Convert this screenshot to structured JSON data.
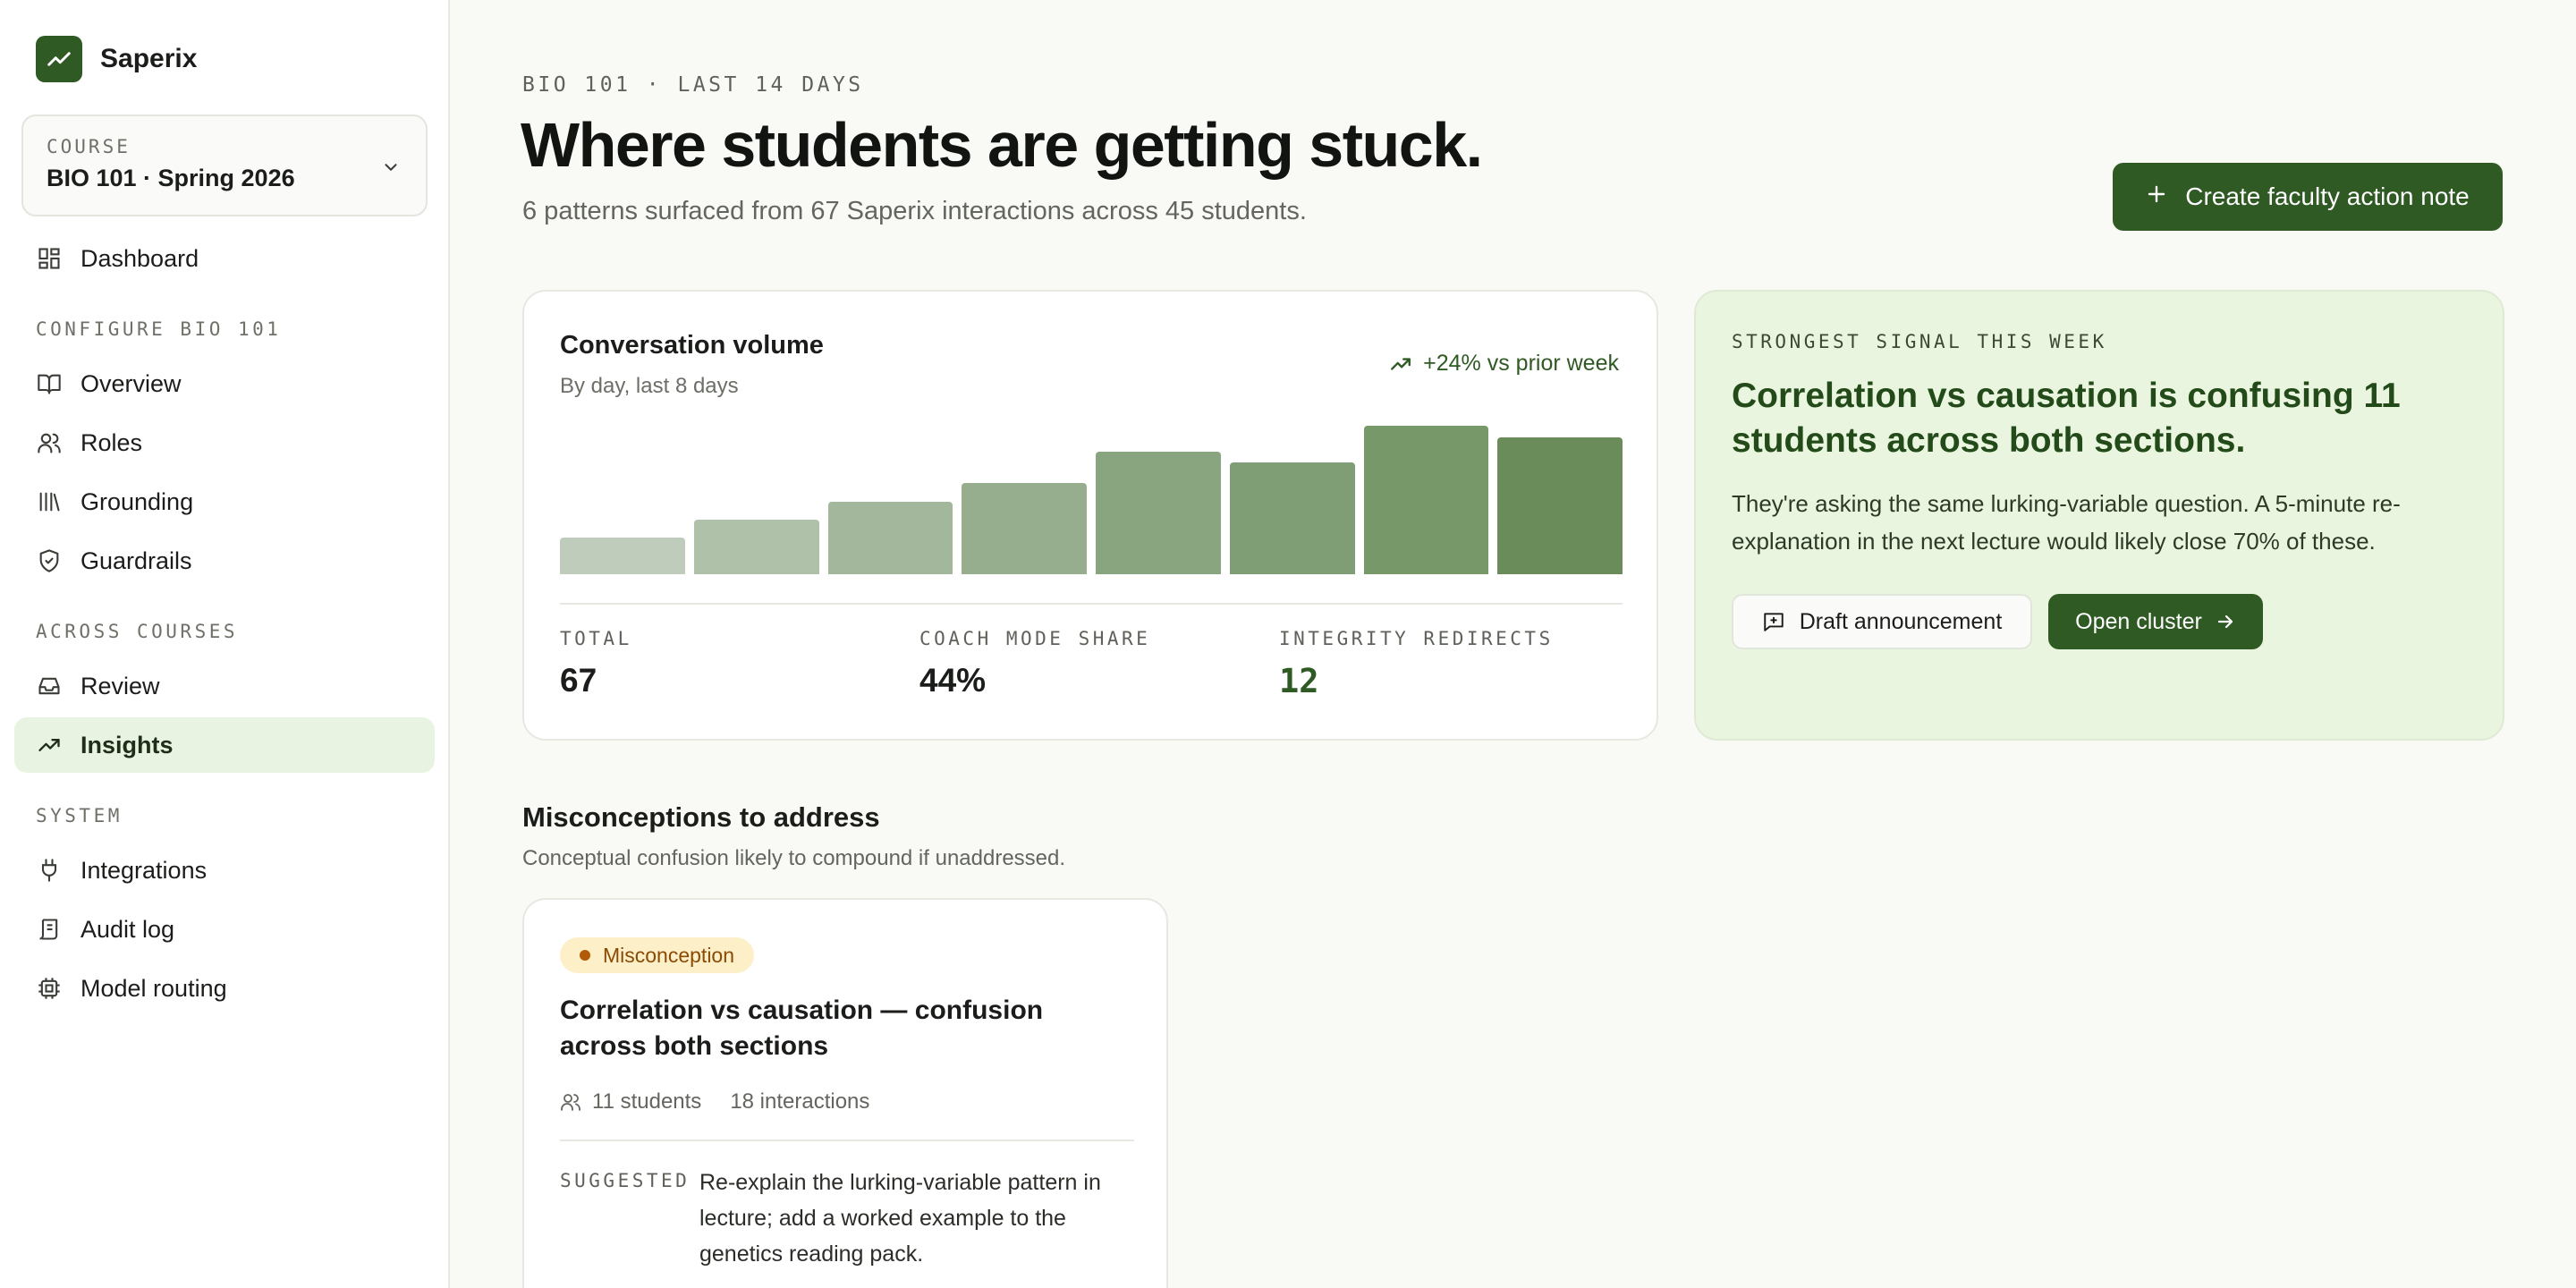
{
  "app": {
    "name": "Saperix"
  },
  "course": {
    "label": "COURSE",
    "value": "BIO 101 · Spring 2026"
  },
  "nav": {
    "dashboard": "Dashboard",
    "section_configure": "CONFIGURE BIO 101",
    "overview": "Overview",
    "roles": "Roles",
    "grounding": "Grounding",
    "guardrails": "Guardrails",
    "section_across": "ACROSS COURSES",
    "review": "Review",
    "insights": "Insights",
    "section_system": "SYSTEM",
    "integrations": "Integrations",
    "audit_log": "Audit log",
    "model_routing": "Model routing",
    "active": "Insights"
  },
  "header": {
    "eyebrow": "BIO 101 · LAST 14 DAYS",
    "title": "Where students are getting stuck.",
    "subtitle": "6 patterns surfaced from 67 Saperix interactions across 45 students.",
    "action_label": "Create faculty action note"
  },
  "volume": {
    "title": "Conversation volume",
    "subtitle": "By day, last 8 days",
    "trend": "+24% vs prior week",
    "stats": {
      "total_label": "TOTAL",
      "total_value": "67",
      "coach_label": "COACH MODE SHARE",
      "coach_value": "44%",
      "integrity_label": "INTEGRITY REDIRECTS",
      "integrity_value": "12"
    }
  },
  "chart_data": {
    "type": "bar",
    "title": "Conversation volume",
    "subtitle": "By day, last 8 days",
    "values": [
      4,
      6,
      8,
      10,
      13.5,
      12.3,
      16.3,
      15
    ],
    "ylim": [
      0,
      16.3
    ],
    "colors": [
      "#c0ccbb",
      "#b0c1aa",
      "#a2b79b",
      "#96ae8e",
      "#89a580",
      "#809e76",
      "#779868",
      "#6a8b5a"
    ]
  },
  "signal": {
    "eyebrow": "STRONGEST SIGNAL THIS WEEK",
    "title": "Correlation vs causation is confusing 11 students across both sections.",
    "body": "They're asking the same lurking-variable question. A 5-minute re-explanation in the next lecture would likely close 70% of these.",
    "draft_label": "Draft announcement",
    "open_label": "Open cluster"
  },
  "misconceptions": {
    "title": "Misconceptions to address",
    "subtitle": "Conceptual confusion likely to compound if unaddressed.",
    "items": [
      {
        "badge": "Misconception",
        "title": "Correlation vs causation — confusion across both sections",
        "students": "11 students",
        "interactions": "18 interactions",
        "suggested_label": "SUGGESTED",
        "suggested_text": "Re-explain the lurking-variable pattern in lecture; add a worked example to the genetics reading pack."
      }
    ]
  }
}
